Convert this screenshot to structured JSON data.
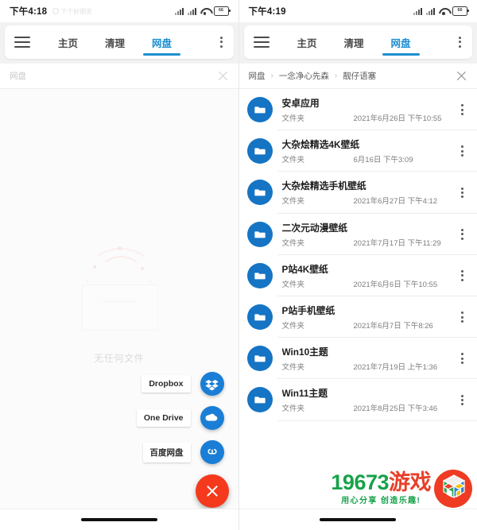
{
  "left": {
    "status": {
      "time": "下午4:18",
      "note": "下个好朋友",
      "battery_label": "66",
      "icons": [
        "signal-icon",
        "signal-icon",
        "wifi-icon",
        "battery-icon"
      ]
    },
    "toolbar": {
      "menu_icon": "hamburger-icon",
      "overflow_icon": "more-vertical-icon",
      "tabs": [
        {
          "label": "主页",
          "active": false
        },
        {
          "label": "清理",
          "active": false
        },
        {
          "label": "网盘",
          "active": true
        }
      ]
    },
    "breadcrumb": {
      "items": [
        "网盘"
      ],
      "close_icon": "close-icon"
    },
    "empty_state": {
      "text": "无任何文件",
      "illustration": "empty-box-illustration"
    },
    "speed_dial": {
      "items": [
        {
          "label": "Dropbox",
          "icon": "dropbox-icon",
          "color": "#1a7ed6"
        },
        {
          "label": "One Drive",
          "icon": "onedrive-icon",
          "color": "#1a7ed6"
        },
        {
          "label": "百度网盘",
          "icon": "baidu-netdisk-icon",
          "color": "#1a7ed6"
        }
      ],
      "fab": {
        "icon": "close-icon",
        "color": "#f4391d"
      }
    }
  },
  "right": {
    "status": {
      "time": "下午4:19",
      "battery_label": "66",
      "icons": [
        "signal-icon",
        "signal-icon",
        "wifi-icon",
        "battery-icon"
      ]
    },
    "toolbar": {
      "menu_icon": "hamburger-icon",
      "overflow_icon": "more-vertical-icon",
      "tabs": [
        {
          "label": "主页",
          "active": false
        },
        {
          "label": "清理",
          "active": false
        },
        {
          "label": "网盘",
          "active": true
        }
      ]
    },
    "breadcrumb": {
      "items": [
        "网盘",
        "一念净心先森",
        "靓仔语塞"
      ],
      "separator": "›",
      "close_icon": "close-icon"
    },
    "file_list": {
      "icon": "folder-icon",
      "icon_color": "#1574c4",
      "rows": [
        {
          "name": "安卓应用",
          "type": "文件夹",
          "date": "2021年6月26日 下午10:55"
        },
        {
          "name": "大杂烩精选4K壁纸",
          "type": "文件夹",
          "date": "6月16日 下午3:09"
        },
        {
          "name": "大杂烩精选手机壁纸",
          "type": "文件夹",
          "date": "2021年6月27日 下午4:12"
        },
        {
          "name": "二次元动漫壁纸",
          "type": "文件夹",
          "date": "2021年7月17日 下午11:29"
        },
        {
          "name": "P站4K壁纸",
          "type": "文件夹",
          "date": "2021年6月6日 下午10:55"
        },
        {
          "name": "P站手机壁纸",
          "type": "文件夹",
          "date": "2021年6月7日 下午8:26"
        },
        {
          "name": "Win10主题",
          "type": "文件夹",
          "date": "2021年7月19日 上午1:36"
        },
        {
          "name": "Win11主题",
          "type": "文件夹",
          "date": "2021年8月25日 下午3:46"
        }
      ]
    },
    "watermark": {
      "number": "19673",
      "word": "游戏",
      "tagline": "用心分享  创造乐趣!",
      "logo": "rubiks-cube-icon",
      "green": "#17a24a",
      "red": "#e8402a"
    }
  }
}
